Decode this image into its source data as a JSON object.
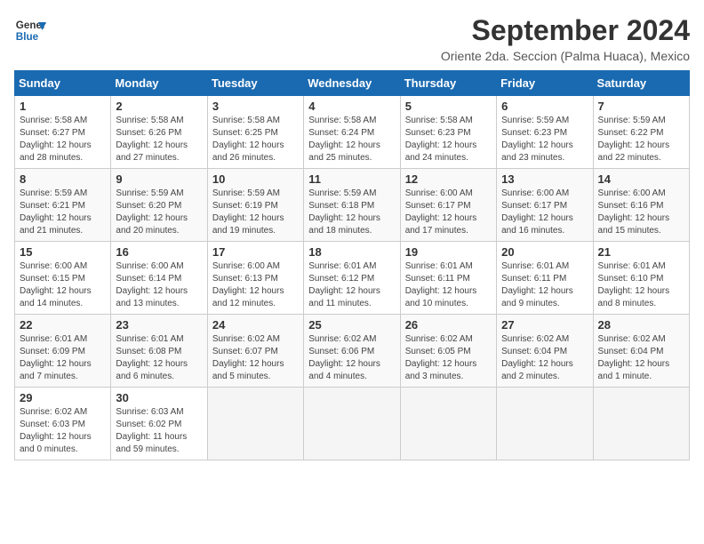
{
  "header": {
    "logo_line1": "General",
    "logo_line2": "Blue",
    "title": "September 2024",
    "subtitle": "Oriente 2da. Seccion (Palma Huaca), Mexico"
  },
  "weekdays": [
    "Sunday",
    "Monday",
    "Tuesday",
    "Wednesday",
    "Thursday",
    "Friday",
    "Saturday"
  ],
  "weeks": [
    [
      {
        "day": "1",
        "info": "Sunrise: 5:58 AM\nSunset: 6:27 PM\nDaylight: 12 hours\nand 28 minutes."
      },
      {
        "day": "2",
        "info": "Sunrise: 5:58 AM\nSunset: 6:26 PM\nDaylight: 12 hours\nand 27 minutes."
      },
      {
        "day": "3",
        "info": "Sunrise: 5:58 AM\nSunset: 6:25 PM\nDaylight: 12 hours\nand 26 minutes."
      },
      {
        "day": "4",
        "info": "Sunrise: 5:58 AM\nSunset: 6:24 PM\nDaylight: 12 hours\nand 25 minutes."
      },
      {
        "day": "5",
        "info": "Sunrise: 5:58 AM\nSunset: 6:23 PM\nDaylight: 12 hours\nand 24 minutes."
      },
      {
        "day": "6",
        "info": "Sunrise: 5:59 AM\nSunset: 6:23 PM\nDaylight: 12 hours\nand 23 minutes."
      },
      {
        "day": "7",
        "info": "Sunrise: 5:59 AM\nSunset: 6:22 PM\nDaylight: 12 hours\nand 22 minutes."
      }
    ],
    [
      {
        "day": "8",
        "info": "Sunrise: 5:59 AM\nSunset: 6:21 PM\nDaylight: 12 hours\nand 21 minutes."
      },
      {
        "day": "9",
        "info": "Sunrise: 5:59 AM\nSunset: 6:20 PM\nDaylight: 12 hours\nand 20 minutes."
      },
      {
        "day": "10",
        "info": "Sunrise: 5:59 AM\nSunset: 6:19 PM\nDaylight: 12 hours\nand 19 minutes."
      },
      {
        "day": "11",
        "info": "Sunrise: 5:59 AM\nSunset: 6:18 PM\nDaylight: 12 hours\nand 18 minutes."
      },
      {
        "day": "12",
        "info": "Sunrise: 6:00 AM\nSunset: 6:17 PM\nDaylight: 12 hours\nand 17 minutes."
      },
      {
        "day": "13",
        "info": "Sunrise: 6:00 AM\nSunset: 6:17 PM\nDaylight: 12 hours\nand 16 minutes."
      },
      {
        "day": "14",
        "info": "Sunrise: 6:00 AM\nSunset: 6:16 PM\nDaylight: 12 hours\nand 15 minutes."
      }
    ],
    [
      {
        "day": "15",
        "info": "Sunrise: 6:00 AM\nSunset: 6:15 PM\nDaylight: 12 hours\nand 14 minutes."
      },
      {
        "day": "16",
        "info": "Sunrise: 6:00 AM\nSunset: 6:14 PM\nDaylight: 12 hours\nand 13 minutes."
      },
      {
        "day": "17",
        "info": "Sunrise: 6:00 AM\nSunset: 6:13 PM\nDaylight: 12 hours\nand 12 minutes."
      },
      {
        "day": "18",
        "info": "Sunrise: 6:01 AM\nSunset: 6:12 PM\nDaylight: 12 hours\nand 11 minutes."
      },
      {
        "day": "19",
        "info": "Sunrise: 6:01 AM\nSunset: 6:11 PM\nDaylight: 12 hours\nand 10 minutes."
      },
      {
        "day": "20",
        "info": "Sunrise: 6:01 AM\nSunset: 6:11 PM\nDaylight: 12 hours\nand 9 minutes."
      },
      {
        "day": "21",
        "info": "Sunrise: 6:01 AM\nSunset: 6:10 PM\nDaylight: 12 hours\nand 8 minutes."
      }
    ],
    [
      {
        "day": "22",
        "info": "Sunrise: 6:01 AM\nSunset: 6:09 PM\nDaylight: 12 hours\nand 7 minutes."
      },
      {
        "day": "23",
        "info": "Sunrise: 6:01 AM\nSunset: 6:08 PM\nDaylight: 12 hours\nand 6 minutes."
      },
      {
        "day": "24",
        "info": "Sunrise: 6:02 AM\nSunset: 6:07 PM\nDaylight: 12 hours\nand 5 minutes."
      },
      {
        "day": "25",
        "info": "Sunrise: 6:02 AM\nSunset: 6:06 PM\nDaylight: 12 hours\nand 4 minutes."
      },
      {
        "day": "26",
        "info": "Sunrise: 6:02 AM\nSunset: 6:05 PM\nDaylight: 12 hours\nand 3 minutes."
      },
      {
        "day": "27",
        "info": "Sunrise: 6:02 AM\nSunset: 6:04 PM\nDaylight: 12 hours\nand 2 minutes."
      },
      {
        "day": "28",
        "info": "Sunrise: 6:02 AM\nSunset: 6:04 PM\nDaylight: 12 hours\nand 1 minute."
      }
    ],
    [
      {
        "day": "29",
        "info": "Sunrise: 6:02 AM\nSunset: 6:03 PM\nDaylight: 12 hours\nand 0 minutes."
      },
      {
        "day": "30",
        "info": "Sunrise: 6:03 AM\nSunset: 6:02 PM\nDaylight: 11 hours\nand 59 minutes."
      },
      {
        "day": "",
        "info": ""
      },
      {
        "day": "",
        "info": ""
      },
      {
        "day": "",
        "info": ""
      },
      {
        "day": "",
        "info": ""
      },
      {
        "day": "",
        "info": ""
      }
    ]
  ]
}
